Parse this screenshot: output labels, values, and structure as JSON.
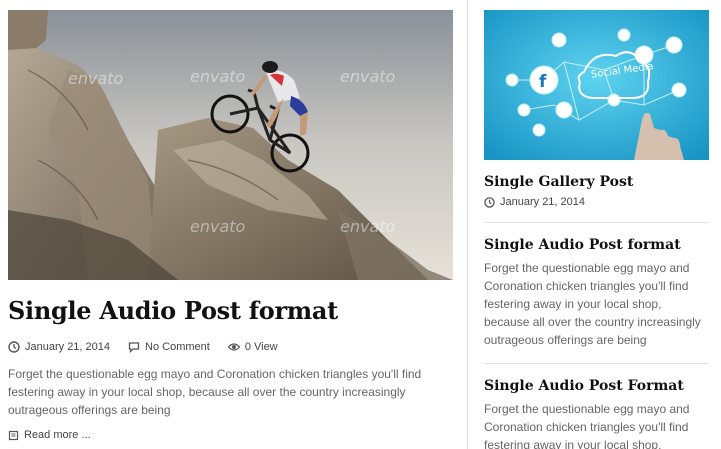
{
  "main_post": {
    "image_alt_icon": "mountain-biker-image",
    "watermark": "envato",
    "title": "Single Audio Post format",
    "date": "January 21, 2014",
    "comments": "No Comment",
    "views": "0 View",
    "excerpt": "Forget the questionable egg mayo and Coronation chicken triangles you'll find festering away in your local shop, because all over the country increasingly outrageous offerings are being",
    "read_more": "Read more ..."
  },
  "sidebar": {
    "gallery_post": {
      "title": "Single Gallery Post",
      "date": "January 21, 2014",
      "image_text": "Social Media"
    },
    "audio_post_1": {
      "title": "Single Audio Post format",
      "excerpt": "Forget the questionable egg mayo and Coronation chicken triangles you'll find festering away in your local shop, because all over the country increasingly outrageous offerings are being"
    },
    "audio_post_2": {
      "title": "Single Audio Post Format",
      "excerpt": "Forget the questionable egg mayo and Coronation chicken triangles you'll find festering away in your local shop,"
    }
  },
  "colors": {
    "title": "#111111",
    "meta": "#444444",
    "excerpt": "#666666",
    "divider": "#e3e3e3",
    "social_bg": "#1fa6d6"
  }
}
